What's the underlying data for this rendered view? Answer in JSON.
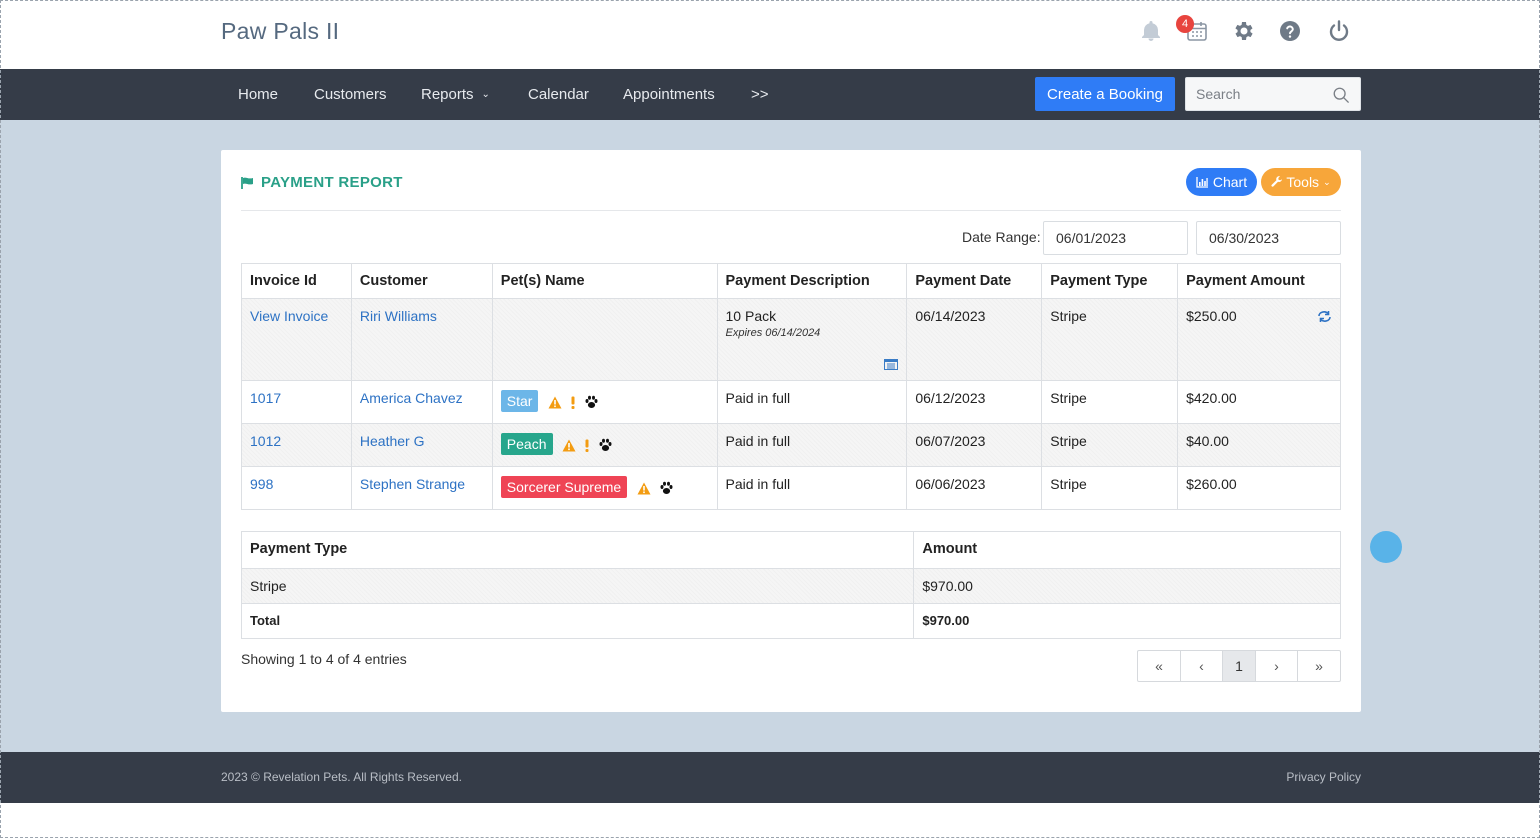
{
  "app": {
    "title": "Paw Pals II",
    "notification_count": "4"
  },
  "nav": {
    "items": [
      "Home",
      "Customers",
      "Reports",
      "Calendar",
      "Appointments",
      ">>"
    ],
    "create_label": "Create a Booking",
    "search_placeholder": "Search"
  },
  "report": {
    "title": "PAYMENT REPORT",
    "chart_label": "Chart",
    "tools_label": "Tools",
    "date_range_label": "Date Range:",
    "date_from": "06/01/2023",
    "date_to": "06/30/2023",
    "columns": [
      "Invoice Id",
      "Customer",
      "Pet(s) Name",
      "Payment Description",
      "Payment Date",
      "Payment Type",
      "Payment Amount"
    ],
    "rows": [
      {
        "invoice": "View Invoice",
        "customer": "Riri Williams",
        "pet": "",
        "description": "10 Pack",
        "description_note": "Expires 06/14/2024",
        "date": "06/14/2023",
        "type": "Stripe",
        "amount": "$250.00"
      },
      {
        "invoice": "1017",
        "customer": "America Chavez",
        "pet": "Star",
        "pet_color": "#6cb6e8",
        "description": "Paid in full",
        "date": "06/12/2023",
        "type": "Stripe",
        "amount": "$420.00"
      },
      {
        "invoice": "1012",
        "customer": "Heather G",
        "pet": "Peach",
        "pet_color": "#27a68c",
        "description": "Paid in full",
        "date": "06/07/2023",
        "type": "Stripe",
        "amount": "$40.00"
      },
      {
        "invoice": "998",
        "customer": "Stephen Strange",
        "pet": "Sorcerer Supreme",
        "pet_color": "#ef4455",
        "description": "Paid in full",
        "date": "06/06/2023",
        "type": "Stripe",
        "amount": "$260.00"
      }
    ],
    "summary": {
      "columns": [
        "Payment Type",
        "Amount"
      ],
      "rows": [
        {
          "type": "Stripe",
          "amount": "$970.00"
        }
      ],
      "total_label": "Total",
      "total_amount": "$970.00"
    },
    "showing": "Showing 1 to 4 of 4 entries",
    "pager": {
      "first": "«",
      "prev": "‹",
      "current": "1",
      "next": "›",
      "last": "»"
    }
  },
  "footer": {
    "copyright": "2023 © Revelation Pets. All Rights Reserved.",
    "privacy": "Privacy Policy"
  },
  "colors": {
    "accent_blue": "#2f7cf6",
    "accent_green": "#2aa088",
    "accent_orange": "#f7a63a",
    "navbar": "#353c48",
    "link": "#2d72c4"
  }
}
